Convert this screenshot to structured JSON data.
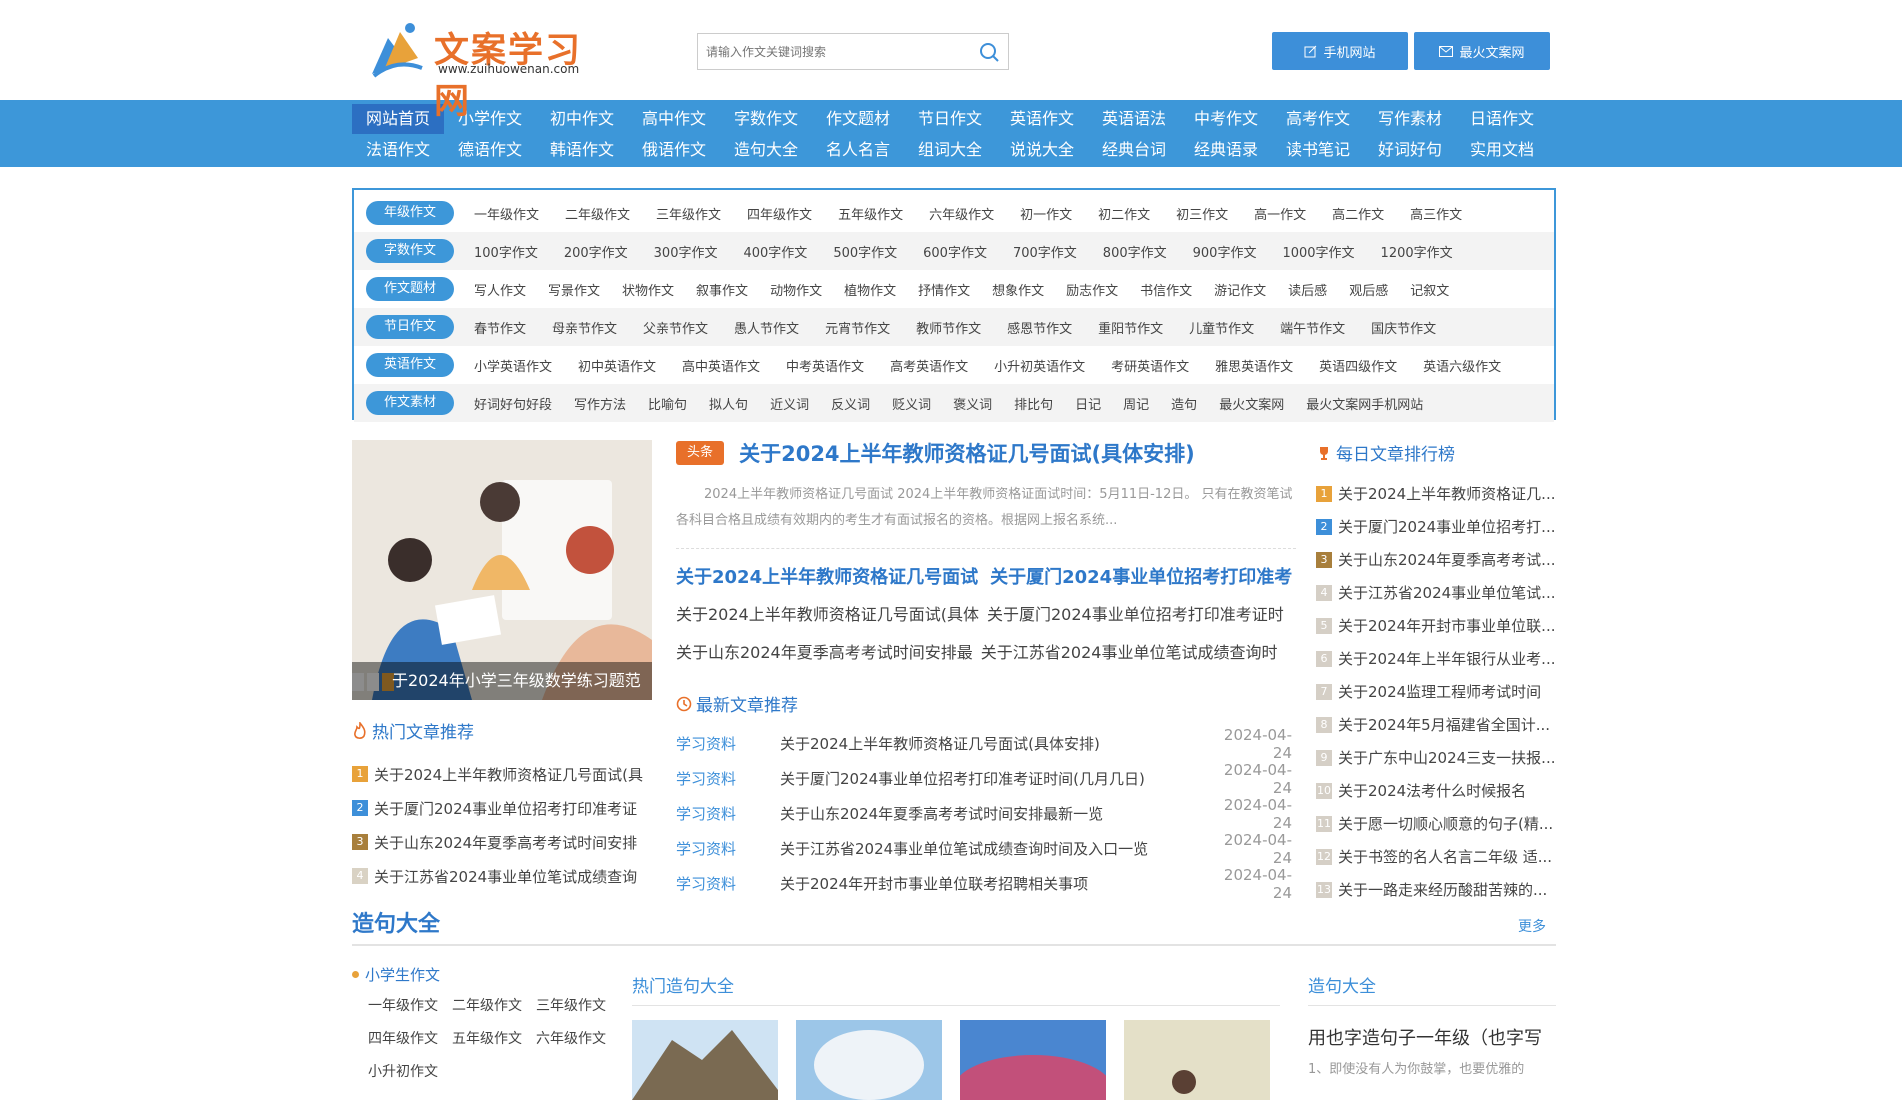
{
  "header": {
    "logo_text": "文案学习网",
    "logo_url": "www.zuihuowenan.com",
    "search_placeholder": "请输入作文关键词搜索",
    "btn_mobile": "手机网站",
    "btn_hot": "最火文案网"
  },
  "nav": {
    "row1": [
      "网站首页",
      "小学作文",
      "初中作文",
      "高中作文",
      "字数作文",
      "作文题材",
      "节日作文",
      "英语作文",
      "英语语法",
      "中考作文",
      "高考作文",
      "写作素材",
      "日语作文"
    ],
    "row2": [
      "法语作文",
      "德语作文",
      "韩语作文",
      "俄语作文",
      "造句大全",
      "名人名言",
      "组词大全",
      "说说大全",
      "经典台词",
      "经典语录",
      "读书笔记",
      "好词好句",
      "实用文档"
    ]
  },
  "categories": [
    {
      "label": "年级作文",
      "items": [
        "一年级作文",
        "二年级作文",
        "三年级作文",
        "四年级作文",
        "五年级作文",
        "六年级作文",
        "初一作文",
        "初二作文",
        "初三作文",
        "高一作文",
        "高二作文",
        "高三作文"
      ]
    },
    {
      "label": "字数作文",
      "items": [
        "100字作文",
        "200字作文",
        "300字作文",
        "400字作文",
        "500字作文",
        "600字作文",
        "700字作文",
        "800字作文",
        "900字作文",
        "1000字作文",
        "1200字作文"
      ]
    },
    {
      "label": "作文题材",
      "items": [
        "写人作文",
        "写景作文",
        "状物作文",
        "叙事作文",
        "动物作文",
        "植物作文",
        "抒情作文",
        "想象作文",
        "励志作文",
        "书信作文",
        "游记作文",
        "读后感",
        "观后感",
        "记叙文"
      ]
    },
    {
      "label": "节日作文",
      "items": [
        "春节作文",
        "母亲节作文",
        "父亲节作文",
        "愚人节作文",
        "元宵节作文",
        "教师节作文",
        "感恩节作文",
        "重阳节作文",
        "儿童节作文",
        "端午节作文",
        "国庆节作文"
      ]
    },
    {
      "label": "英语作文",
      "items": [
        "小学英语作文",
        "初中英语作文",
        "高中英语作文",
        "中考英语作文",
        "高考英语作文",
        "小升初英语作文",
        "考研英语作文",
        "雅思英语作文",
        "英语四级作文",
        "英语六级作文"
      ]
    },
    {
      "label": "作文素材",
      "items": [
        "好词好句好段",
        "写作方法",
        "比喻句",
        "拟人句",
        "近义词",
        "反义词",
        "贬义词",
        "褒义词",
        "排比句",
        "日记",
        "周记",
        "造句",
        "最火文案网",
        "最火文案网手机网站"
      ]
    }
  ],
  "banner": {
    "caption": "于2024年小学三年级数学练习题范"
  },
  "hot": {
    "title": "热门文章推荐",
    "items": [
      "关于2024上半年教师资格证几号面试(具",
      "关于厦门2024事业单位招考打印准考证",
      "关于山东2024年夏季高考考试时间安排",
      "关于江苏省2024事业单位笔试成绩查询"
    ]
  },
  "headline": {
    "tag": "头条",
    "title": "关于2024上半年教师资格证几号面试(具体安排)",
    "desc": "2024上半年教师资格证几号面试 2024上半年教师资格证面试时间：5月11日-12日。 只有在教资笔试各科目合格且成绩有效期内的考生才有面试报名的资格。根据网上报名系统..."
  },
  "sub": {
    "heads": [
      "关于2024上半年教师资格证几号面试",
      "关于厦门2024事业单位招考打印准考"
    ],
    "line1": [
      "关于2024上半年教师资格证几号面试(具体",
      "关于厦门2024事业单位招考打印准考证时"
    ],
    "line2": [
      "关于山东2024年夏季高考考试时间安排最",
      "关于江苏省2024事业单位笔试成绩查询时"
    ]
  },
  "latest": {
    "title": "最新文章推荐",
    "items": [
      {
        "type": "学习资料",
        "title": "关于2024上半年教师资格证几号面试(具体安排)",
        "date": "2024-04-24"
      },
      {
        "type": "学习资料",
        "title": "关于厦门2024事业单位招考打印准考证时间(几月几日)",
        "date": "2024-04-24"
      },
      {
        "type": "学习资料",
        "title": "关于山东2024年夏季高考考试时间安排最新一览",
        "date": "2024-04-24"
      },
      {
        "type": "学习资料",
        "title": "关于江苏省2024事业单位笔试成绩查询时间及入口一览",
        "date": "2024-04-24"
      },
      {
        "type": "学习资料",
        "title": "关于2024年开封市事业单位联考招聘相关事项",
        "date": "2024-04-24"
      }
    ]
  },
  "rank": {
    "title": "每日文章排行榜",
    "items": [
      "关于2024上半年教师资格证几...",
      "关于厦门2024事业单位招考打...",
      "关于山东2024年夏季高考考试...",
      "关于江苏省2024事业单位笔试...",
      "关于2024年开封市事业单位联...",
      "关于2024年上半年银行从业考...",
      "关于2024监理工程师考试时间",
      "关于2024年5月福建省全国计...",
      "关于广东中山2024三支一扶报...",
      "关于2024法考什么时候报名",
      "关于愿一切顺心顺意的句子(精...",
      "关于书签的名人名言二年级 适...",
      "关于一路走来经历酸甜苦辣的..."
    ]
  },
  "zaoju": {
    "title": "造句大全",
    "more": "更多",
    "left_title": "小学生作文",
    "left_items": [
      "一年级作文",
      "二年级作文",
      "三年级作文",
      "四年级作文",
      "五年级作文",
      "六年级作文",
      "小升初作文"
    ],
    "mid_title": "热门造句大全",
    "right_title": "造句大全",
    "right_head": "用也字造句子一年级（也字写",
    "right_desc": "1、即使没有人为你鼓掌，也要优雅的"
  },
  "colors": {
    "accent": "#3d97d9",
    "orange": "#e8702a",
    "title_blue": "#2e78c9"
  }
}
